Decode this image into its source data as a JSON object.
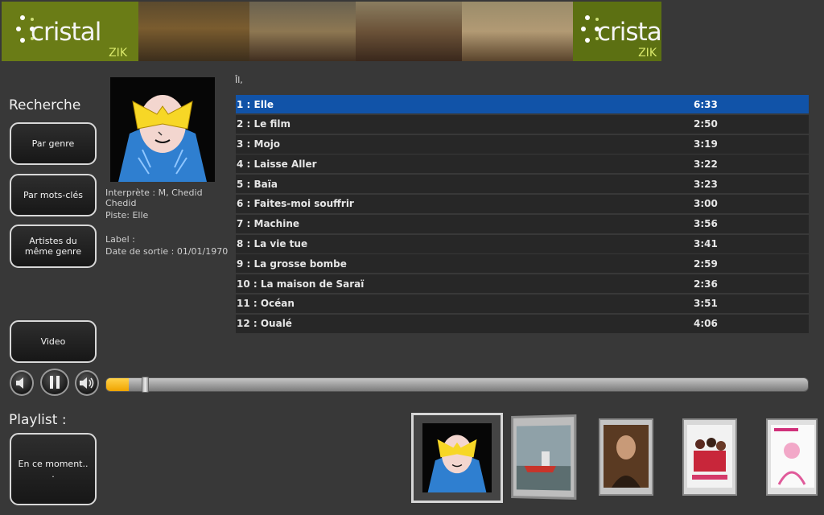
{
  "banner": {
    "logo_left": {
      "word": "cristal",
      "sub": "ZIK"
    },
    "logo_right": {
      "word": "cristal",
      "sub": "ZIK"
    }
  },
  "sidebar": {
    "recherche_label": "Recherche",
    "buttons": {
      "par_genre": "Par genre",
      "par_mots_cles": "Par mots-clés",
      "artistes_line1": "Artistes du",
      "artistes_line2": "même genre",
      "video": "Video"
    },
    "playlist_label": "Playlist :",
    "en_ce_moment_line1": "En ce moment..",
    "en_ce_moment_line2": "."
  },
  "now_playing": {
    "interprete_line1": "Interprète : M, Chedid",
    "interprete_line2": "Chedid",
    "piste": "Piste: Elle",
    "label": "Label :",
    "date_sortie": "Date de sortie : 01/01/1970"
  },
  "tracklist": {
    "title": "Îl,",
    "selected_index": 0,
    "tracks": [
      {
        "title": "1 : Elle",
        "duration": "6:33"
      },
      {
        "title": "2 : Le film",
        "duration": "2:50"
      },
      {
        "title": "3 : Mojo",
        "duration": "3:19"
      },
      {
        "title": "4 : Laisse Aller",
        "duration": "3:22"
      },
      {
        "title": "5 : Baïa",
        "duration": "3:23"
      },
      {
        "title": "6 : Faites-moi souffrir",
        "duration": "3:00"
      },
      {
        "title": "7 : Machine",
        "duration": "3:56"
      },
      {
        "title": "8 : La vie tue",
        "duration": "3:41"
      },
      {
        "title": "9 : La grosse bombe",
        "duration": "2:59"
      },
      {
        "title": "10 : La maison de Saraï",
        "duration": "2:36"
      },
      {
        "title": "11 : Océan",
        "duration": "3:51"
      },
      {
        "title": "12 : Oualé",
        "duration": "4:06"
      }
    ]
  },
  "player": {
    "progress_fraction": 0.03,
    "accent_color": "#f5b400",
    "selected_row_color": "#1153a8"
  },
  "icons": {
    "vol_down": "speaker-down-icon",
    "pause": "pause-icon",
    "vol_up": "speaker-up-icon"
  }
}
